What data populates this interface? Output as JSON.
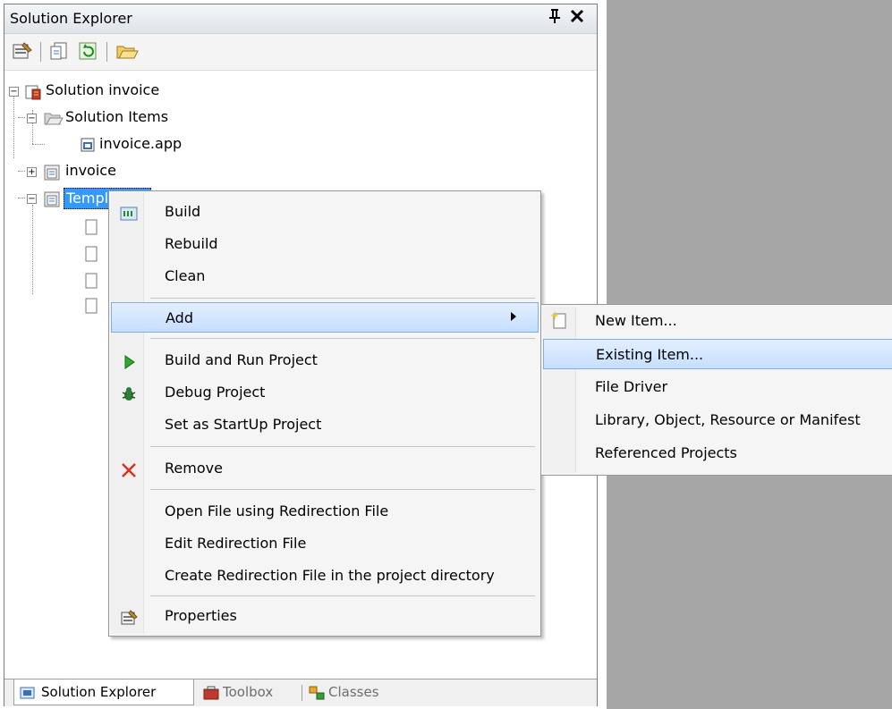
{
  "panel": {
    "title": "Solution Explorer",
    "pin_glyph": "H",
    "close_glyph": "✕"
  },
  "toolbar": {
    "items": [
      {
        "icon": "properties-icon"
      },
      {
        "icon": "show-all-files-icon"
      },
      {
        "icon": "refresh-icon"
      },
      {
        "icon": "open-folder-icon"
      }
    ]
  },
  "tree": {
    "solution": "Solution invoice",
    "solution_items": "Solution Items",
    "invoice_app": "invoice.app",
    "invoice": "invoice",
    "selected": "Templates"
  },
  "context_menu": {
    "build": "Build",
    "rebuild": "Rebuild",
    "clean": "Clean",
    "add": "Add",
    "build_and_run": "Build and Run Project",
    "debug": "Debug Project",
    "startup": "Set as StartUp Project",
    "remove": "Remove",
    "open_redirection": "Open File using Redirection File",
    "edit_redirection": "Edit Redirection File",
    "create_redirection": "Create Redirection File in the project directory",
    "properties": "Properties"
  },
  "add_submenu": {
    "new_item": "New Item...",
    "existing_item": "Existing Item...",
    "file_driver": "File Driver",
    "library": "Library, Object, Resource or Manifest",
    "referenced": "Referenced Projects"
  },
  "bottom_tabs": {
    "solution_explorer": "Solution Explorer",
    "toolbox": "Toolbox",
    "classes": "Classes"
  },
  "colors": {
    "selection": "#3399ff",
    "menu_highlight": "#c6deff",
    "background_gray": "#a6a6a6"
  }
}
